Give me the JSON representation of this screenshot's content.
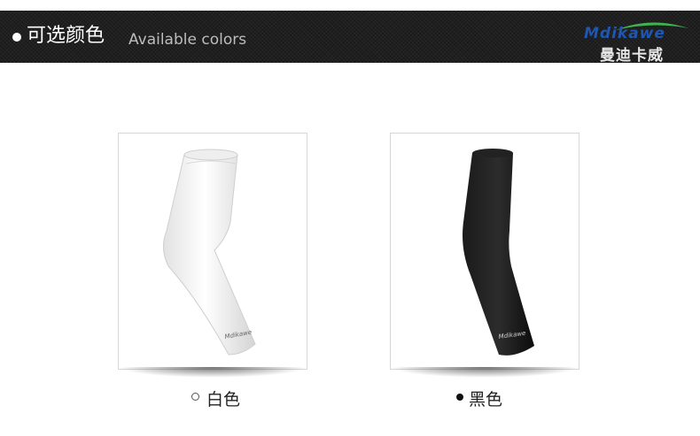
{
  "banner": {
    "title": "可选颜色",
    "subtitle": "Available colors",
    "bullet_icon": "white-dot-icon"
  },
  "logo": {
    "wordmark": "Mdikawe",
    "chinese_name": "曼迪卡威",
    "brand_color": "#1e56b0",
    "swoosh_color": "#3fb34f"
  },
  "products": [
    {
      "color_name": "白色",
      "swatch": "#f4f4f4",
      "marker_icon": "open-circle-icon",
      "print_text": "Mdikawe"
    },
    {
      "color_name": "黑色",
      "swatch": "#111111",
      "marker_icon": "filled-circle-icon",
      "print_text": "Mdikawe"
    }
  ]
}
